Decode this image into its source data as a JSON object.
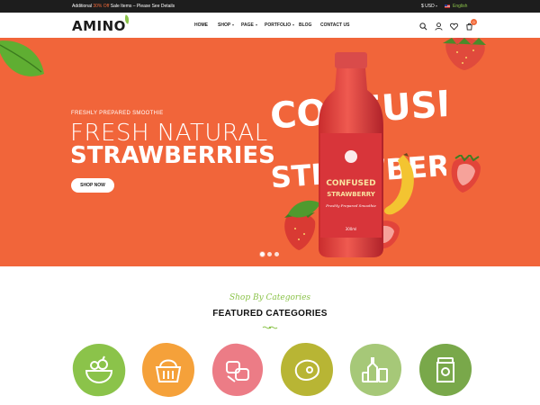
{
  "topbar": {
    "promo_prefix": "Additional ",
    "promo_highlight": "30% Off",
    "promo_suffix": " Sale Items – Please See Details",
    "currency": "$ USD",
    "language": "English"
  },
  "header": {
    "logo": "AMINO",
    "nav": [
      {
        "label": "HOME"
      },
      {
        "label": "SHOP"
      },
      {
        "label": "PAGE"
      },
      {
        "label": "PORTFOLIO"
      },
      {
        "label": "BLOG"
      },
      {
        "label": "CONTACT US"
      }
    ],
    "cart_count": "0",
    "icons": [
      "search-icon",
      "user-icon",
      "heart-icon",
      "cart-icon"
    ]
  },
  "hero": {
    "eyebrow": "FRESHLY PREPARED SMOOTHIE",
    "title_line1": "FRESH NATURAL",
    "title_line2": "STRAWBERRIES",
    "button": "SHOP NOW",
    "bg_text_line1": "CONFUSED",
    "bg_text_line2": "STRAWBERRY",
    "bottle_label_line1": "CONFUSED",
    "bottle_label_line2": "STRAWBERRY",
    "bottle_label_sub": "Freshly Prepared Smoothie",
    "bottle_volume": "300ml",
    "slides": 3,
    "active_slide": 1,
    "background_color": "#f1653a"
  },
  "categories": {
    "subtitle": "Shop By Categories",
    "title": "FEATURED CATEGORIES",
    "items": [
      {
        "icon": "fruit-bowl-icon",
        "color": "#8bc34a"
      },
      {
        "icon": "basket-icon",
        "color": "#f5a13a"
      },
      {
        "icon": "bread-icon",
        "color": "#ec7c86"
      },
      {
        "icon": "meat-icon",
        "color": "#b8b534"
      },
      {
        "icon": "bottles-icon",
        "color": "#a6c878"
      },
      {
        "icon": "jar-icon",
        "color": "#79a84a"
      }
    ]
  }
}
